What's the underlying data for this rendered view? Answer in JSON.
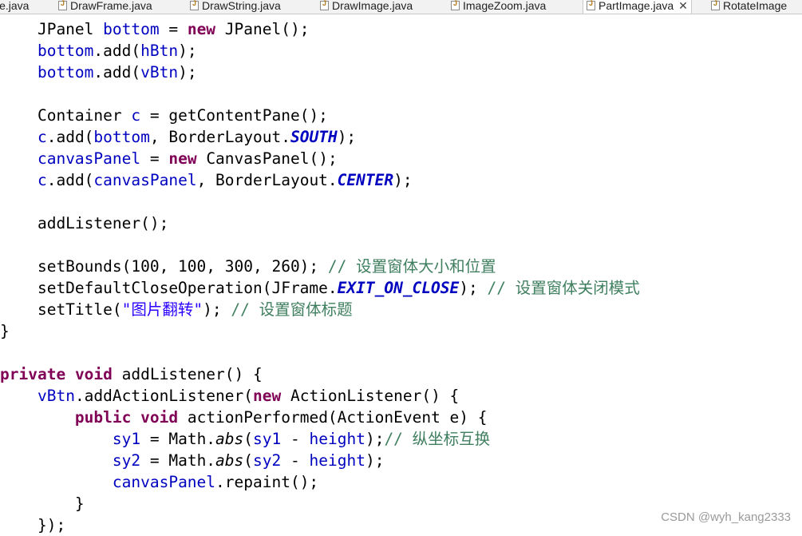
{
  "tabs": [
    {
      "label": "le.java"
    },
    {
      "label": "DrawFrame.java"
    },
    {
      "label": "DrawString.java"
    },
    {
      "label": "DrawImage.java"
    },
    {
      "label": "ImageZoom.java"
    },
    {
      "label": "PartImage.java",
      "active": true,
      "close": "✕"
    },
    {
      "label": "RotateImage"
    }
  ],
  "editor": {
    "lines": [
      [
        {
          "t": "    JPanel "
        },
        {
          "t": "bottom",
          "c": "fld"
        },
        {
          "t": " = "
        },
        {
          "t": "new",
          "c": "kw"
        },
        {
          "t": " JPanel();"
        }
      ],
      [
        {
          "t": "    "
        },
        {
          "t": "bottom",
          "c": "fld"
        },
        {
          "t": ".add("
        },
        {
          "t": "hBtn",
          "c": "fld"
        },
        {
          "t": ");"
        }
      ],
      [
        {
          "t": "    "
        },
        {
          "t": "bottom",
          "c": "fld"
        },
        {
          "t": ".add("
        },
        {
          "t": "vBtn",
          "c": "fld"
        },
        {
          "t": ");"
        }
      ],
      [],
      [
        {
          "t": "    Container "
        },
        {
          "t": "c",
          "c": "fld"
        },
        {
          "t": " = getContentPane();"
        }
      ],
      [
        {
          "t": "    "
        },
        {
          "t": "c",
          "c": "fld"
        },
        {
          "t": ".add("
        },
        {
          "t": "bottom",
          "c": "fld"
        },
        {
          "t": ", BorderLayout."
        },
        {
          "t": "SOUTH",
          "c": "sfld"
        },
        {
          "t": ");"
        }
      ],
      [
        {
          "t": "    "
        },
        {
          "t": "canvasPanel",
          "c": "fld"
        },
        {
          "t": " = "
        },
        {
          "t": "new",
          "c": "kw"
        },
        {
          "t": " CanvasPanel();"
        }
      ],
      [
        {
          "t": "    "
        },
        {
          "t": "c",
          "c": "fld"
        },
        {
          "t": ".add("
        },
        {
          "t": "canvasPanel",
          "c": "fld"
        },
        {
          "t": ", BorderLayout."
        },
        {
          "t": "CENTER",
          "c": "sfld"
        },
        {
          "t": ");"
        }
      ],
      [],
      [
        {
          "t": "    addListener();"
        }
      ],
      [],
      [
        {
          "t": "    setBounds(100, 100, 300, 260); "
        },
        {
          "t": "// 设置窗体大小和位置",
          "c": "cmt"
        }
      ],
      [
        {
          "t": "    setDefaultCloseOperation(JFrame."
        },
        {
          "t": "EXIT_ON_CLOSE",
          "c": "sfld"
        },
        {
          "t": "); "
        },
        {
          "t": "// 设置窗体关闭模式",
          "c": "cmt"
        }
      ],
      [
        {
          "t": "    setTitle("
        },
        {
          "t": "\"图片翻转\"",
          "c": "str"
        },
        {
          "t": "); "
        },
        {
          "t": "// 设置窗体标题",
          "c": "cmt"
        }
      ],
      [
        {
          "t": "}"
        }
      ],
      [],
      [
        {
          "t": "private",
          "c": "kw"
        },
        {
          "t": " "
        },
        {
          "t": "void",
          "c": "kw"
        },
        {
          "t": " addListener() {"
        }
      ],
      [
        {
          "t": "    "
        },
        {
          "t": "vBtn",
          "c": "fld"
        },
        {
          "t": ".addActionListener("
        },
        {
          "t": "new",
          "c": "kw"
        },
        {
          "t": " ActionListener() {"
        }
      ],
      [
        {
          "t": "        "
        },
        {
          "t": "public",
          "c": "kw"
        },
        {
          "t": " "
        },
        {
          "t": "void",
          "c": "kw"
        },
        {
          "t": " actionPerformed(ActionEvent e) {"
        }
      ],
      [
        {
          "t": "            "
        },
        {
          "t": "sy1",
          "c": "fld"
        },
        {
          "t": " = Math."
        },
        {
          "t": "abs",
          "c": "mth"
        },
        {
          "t": "("
        },
        {
          "t": "sy1",
          "c": "fld"
        },
        {
          "t": " - "
        },
        {
          "t": "height",
          "c": "fld"
        },
        {
          "t": ");"
        },
        {
          "t": "// 纵坐标互换",
          "c": "cmt"
        }
      ],
      [
        {
          "t": "            "
        },
        {
          "t": "sy2",
          "c": "fld"
        },
        {
          "t": " = Math."
        },
        {
          "t": "abs",
          "c": "mth"
        },
        {
          "t": "("
        },
        {
          "t": "sy2",
          "c": "fld"
        },
        {
          "t": " - "
        },
        {
          "t": "height",
          "c": "fld"
        },
        {
          "t": ");"
        }
      ],
      [
        {
          "t": "            "
        },
        {
          "t": "canvasPanel",
          "c": "fld"
        },
        {
          "t": ".repaint();"
        }
      ],
      [
        {
          "t": "        }"
        }
      ],
      [
        {
          "t": "    });"
        }
      ]
    ]
  },
  "watermark": "CSDN @wyh_kang2333",
  "colors": {
    "keyword": "#7f0055",
    "field": "#0000c0",
    "string": "#2a00ff",
    "comment": "#3f7f5f"
  }
}
